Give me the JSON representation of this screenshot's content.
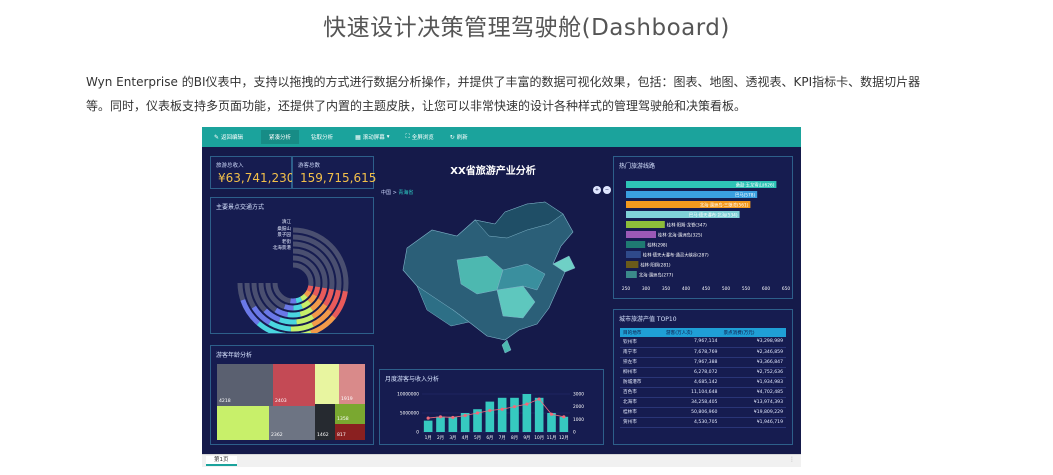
{
  "page": {
    "title": "快速设计决策管理驾驶舱(Dashboard)",
    "intro_line1": "Wyn Enterprise 的BI仪表中，支持以拖拽的方式进行数据分析操作，并提供了丰富的数据可视化效果，包括：图表、地图、透视表、KPI指标卡、数据切片器",
    "intro_line2": "等。同时，仪表板支持多页面功能，还提供了内置的主题皮肤，让您可以非常快速的设计各种样式的管理驾驶舱和决策看板。"
  },
  "toolbar": {
    "items": [
      {
        "label": "返回编辑",
        "icon": "pencil-icon"
      },
      {
        "label": "紧凑分析",
        "icon": "",
        "active": true
      },
      {
        "label": "钻取分析",
        "icon": ""
      },
      {
        "label": "滚动屏幕",
        "icon": "table-icon"
      },
      {
        "label": "全屏浏览",
        "icon": "fullscreen-icon"
      },
      {
        "label": "刷新",
        "icon": "refresh-icon"
      }
    ]
  },
  "kpi": {
    "revenue_label": "旅游总收入",
    "revenue_value": "¥63,741,230",
    "visitors_label": "游客总数",
    "visitors_value": "159,715,615"
  },
  "transport": {
    "title": "主要景点交通方式",
    "legend": [
      "滇江",
      "桑鼓山",
      "景子园",
      "老街",
      "北海景港"
    ],
    "colors": [
      "#e85a5a",
      "#f29a4a",
      "#c6f06a",
      "#4ad6e0",
      "#6a78e8",
      "#4a4f70"
    ]
  },
  "age": {
    "title": "游客年龄分析",
    "cells": [
      {
        "label": "4218",
        "color": "#5a6070"
      },
      {
        "label": "2403",
        "color": "#c44a55"
      },
      {
        "label": "",
        "color": "#e8f5a0"
      },
      {
        "label": "1919",
        "color": "#d98a8a"
      },
      {
        "label": "",
        "color": "#c8f06a"
      },
      {
        "label": "2362",
        "color": "#6d7483"
      },
      {
        "label": "1462",
        "color": "#262a30"
      },
      {
        "label": "1358",
        "color": "#7aa830"
      },
      {
        "label": "817",
        "color": "#8a2020"
      }
    ]
  },
  "map": {
    "title": "XX省旅游产业分析",
    "crumb_root": "中国",
    "crumb_sep": ">",
    "crumb_current": "青海省",
    "btn_plus": "+",
    "btn_minus": "−"
  },
  "routes": {
    "title": "热门旅游线路",
    "color_main": "#2ec4b6"
  },
  "monthly": {
    "title": "月度游客与收入分析"
  },
  "city_table": {
    "title": "城市旅游产值 TOP10",
    "headers": [
      "目的地市",
      "游客(万人次)",
      "景点消费(万元)"
    ],
    "rows": [
      [
        "钦州市",
        "7,967,114",
        "¥3,298,989"
      ],
      [
        "南宁市",
        "7,678,769",
        "¥2,346,859"
      ],
      [
        "崇左市",
        "7,967,388",
        "¥3,366,847"
      ],
      [
        "柳州市",
        "6,278,072",
        "¥2,752,636"
      ],
      [
        "防城港市",
        "4,685,142",
        "¥1,934,983"
      ],
      [
        "百色市",
        "11,104,648",
        "¥4,702,485"
      ],
      [
        "北海市",
        "34,258,405",
        "¥13,974,393"
      ],
      [
        "桂林市",
        "50,806,960",
        "¥19,809,229"
      ],
      [
        "贺州市",
        "4,530,705",
        "¥1,946,719"
      ]
    ]
  },
  "sheet": {
    "tab": "第1页",
    "dots": "⋮"
  },
  "chart_data": [
    {
      "type": "bar",
      "orientation": "horizontal",
      "categories": [
        "桑鼓·玉龙雪山",
        "巴马",
        "北海·涠洲岛·三娘湾",
        "巴马·德天瀑布·北海",
        "桂林·阳朔·龙脊",
        "桂林·北海·涠洲岛",
        "桂林",
        "桂林·德天大瀑布·通灵大峡谷",
        "桂林·阳朔",
        "北海·涠洲岛"
      ],
      "value_labels": [
        "626",
        "578",
        "561",
        "534",
        "347",
        "325",
        "298",
        "287",
        "281",
        "277"
      ],
      "values": [
        626,
        578,
        561,
        534,
        347,
        325,
        298,
        287,
        281,
        277
      ],
      "colors": [
        "#2ec4b6",
        "#3a9fe0",
        "#f39a1e",
        "#7fd1d8",
        "#8dbd3a",
        "#9b59b6",
        "#1f7a72",
        "#2f4a8a",
        "#6b5b1a",
        "#3b8a8a"
      ],
      "x_ticks": [
        "250",
        "300",
        "350",
        "400",
        "450",
        "500",
        "550",
        "600",
        "650"
      ],
      "xlim": [
        250,
        650
      ]
    },
    {
      "type": "bar",
      "categories": [
        "1月",
        "2月",
        "3月",
        "4月",
        "5月",
        "6月",
        "7月",
        "8月",
        "9月",
        "10月",
        "11月",
        "12月"
      ],
      "series": [
        {
          "values": [
            3,
            4,
            4,
            5,
            6,
            8,
            9,
            9,
            10,
            9,
            5,
            4
          ]
        },
        {
          "values": [
            1100,
            1200,
            1150,
            1300,
            1500,
            1700,
            1800,
            2000,
            2200,
            2600,
            1400,
            1200
          ]
        }
      ],
      "y_left_ticks": [
        "10000000",
        "5000000",
        "0"
      ],
      "y_right_ticks": [
        "3000",
        "2000",
        "1000",
        "0"
      ],
      "colors": [
        "#36c9c0",
        "#f06a7a"
      ]
    }
  ]
}
